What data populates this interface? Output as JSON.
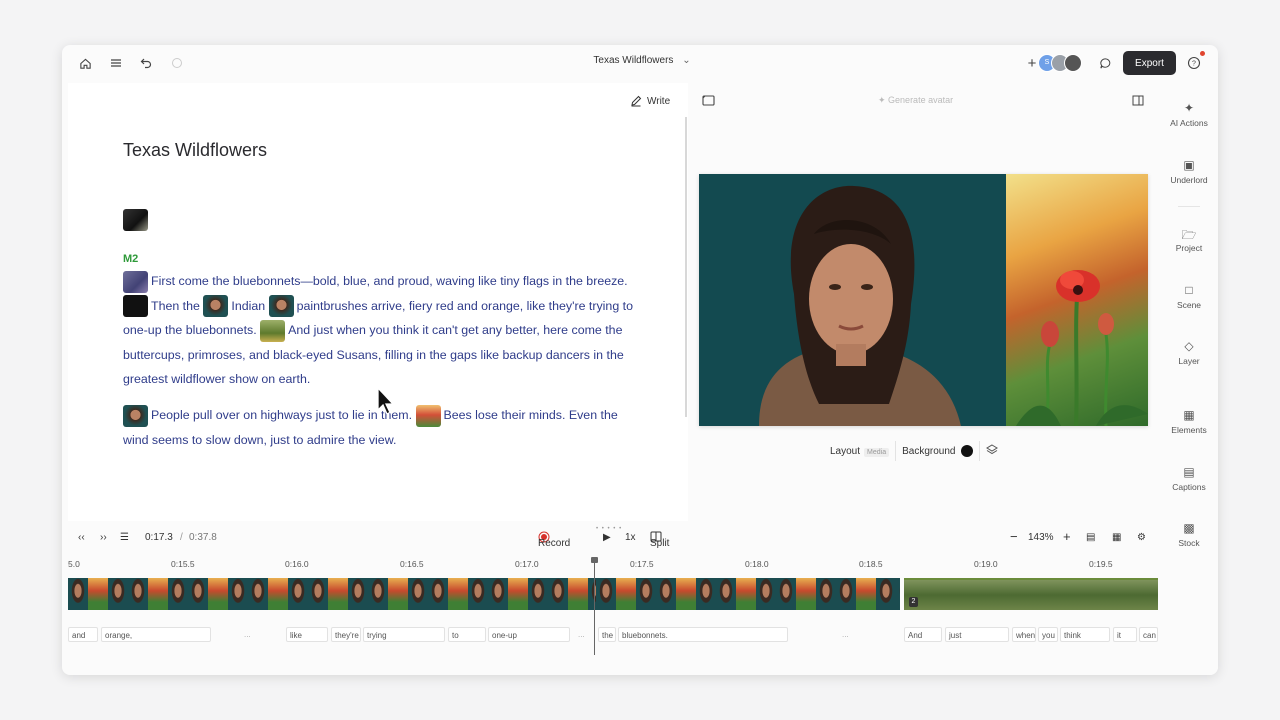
{
  "topbar": {
    "doc_title": "Texas Wildflowers",
    "export_label": "Export",
    "avatar_initial": "S"
  },
  "editor": {
    "write_label": "Write",
    "title": "Texas Wildflowers",
    "speaker": "M2",
    "p1": {
      "s1": "First come the bluebonnets—bold, blue, and proud, waving like tiny flags in the breeze.",
      "s2": "Then the",
      "s3": "Indian",
      "s4": "paintbrushes arrive, fiery red and orange, like they're trying to one-up the bluebonnets.",
      "s5": "And just when you think it can't get any better, here come the buttercups, primroses, and black-eyed Susans, filling in the gaps like backup dancers in the greatest wildflower show on earth."
    },
    "p2": {
      "s1": "People pull over on highways just to lie in them.",
      "s2": "Bees lose their minds. Even the wind seems to slow down, just to admire the view."
    }
  },
  "preview": {
    "generate_avatar_label": "Generate avatar",
    "layout_label": "Layout",
    "media_tag": "Media",
    "background_label": "Background"
  },
  "sidebar": {
    "items": [
      {
        "label": "AI Actions",
        "icon": "sparkle-icon"
      },
      {
        "label": "Underlord",
        "icon": "robot-icon"
      },
      {
        "label": "Project",
        "icon": "folder-icon"
      },
      {
        "label": "Scene",
        "icon": "scene-icon"
      },
      {
        "label": "Layer",
        "icon": "layers-icon"
      },
      {
        "label": "Elements",
        "icon": "elements-icon"
      },
      {
        "label": "Captions",
        "icon": "captions-icon"
      },
      {
        "label": "Stock",
        "icon": "stock-icon"
      }
    ]
  },
  "timeline": {
    "current_time": "0:17.3",
    "separator": "/",
    "total_time": "0:37.8",
    "record_label": "Record",
    "speed": "1x",
    "split_label": "Split",
    "zoom": "143%",
    "ruler": [
      "5.0",
      "0:15.5",
      "0:16.0",
      "0:16.5",
      "0:17.0",
      "0:17.5",
      "0:18.0",
      "0:18.5",
      "0:19.0",
      "0:19.5"
    ],
    "scene_badge": "2",
    "words": [
      "and",
      "orange,",
      "...",
      "like",
      "they're",
      "trying",
      "to",
      "one-up",
      "...",
      "the",
      "bluebonnets.",
      "...",
      "And",
      "just",
      "when",
      "you",
      "think",
      "it",
      "can"
    ]
  },
  "colors": {
    "accent_green": "#2f9a3a",
    "transcript_blue": "#2f3c8a",
    "export_bg": "#2b2b2f",
    "record_red": "#d6312b"
  }
}
